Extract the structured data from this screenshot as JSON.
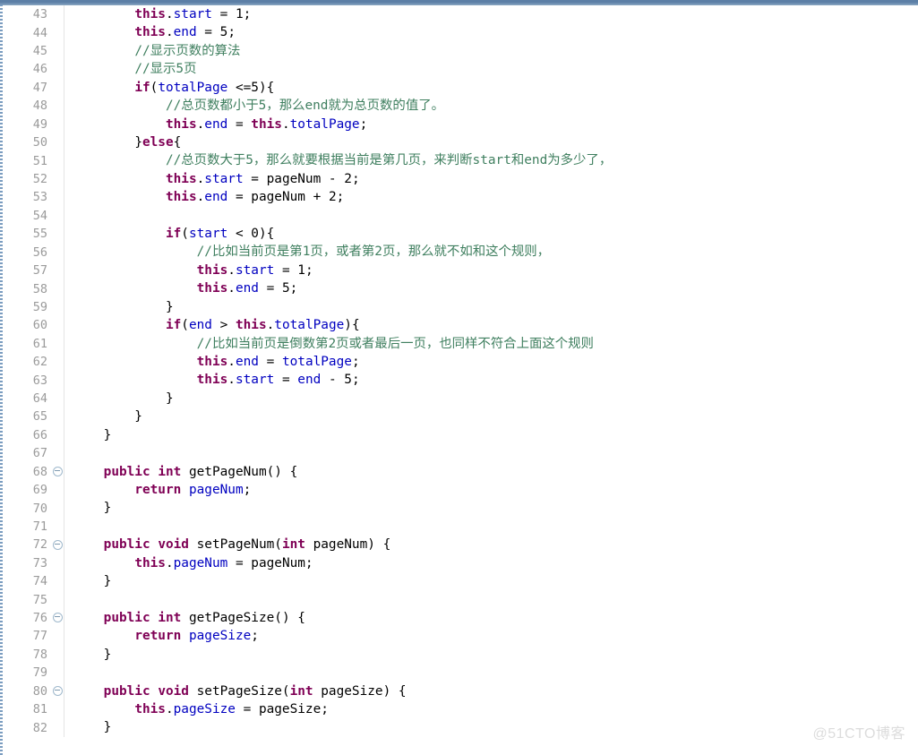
{
  "window": {
    "chrome_accent": "#5c7fa6",
    "background": "#ffffff"
  },
  "editor": {
    "language": "Java",
    "first_visible_line": 43,
    "last_visible_line": 82,
    "gutter_separator_color": "#e4e4e4",
    "line_number_color": "#9a9a9a",
    "fold_marker_icon": "collapse-circle-minus-icon",
    "theme": {
      "keyword": "#7f0055",
      "field": "#0000c0",
      "comment": "#3f7f5f",
      "text": "#000000"
    }
  },
  "watermark": {
    "text": "@51CTO博客",
    "color": "#dcdcdc"
  },
  "code_lines": [
    {
      "n": 43,
      "fold": false,
      "tokens": [
        {
          "t": "        ",
          "c": "plain"
        },
        {
          "t": "this",
          "c": "kw"
        },
        {
          "t": ".",
          "c": "punc"
        },
        {
          "t": "start",
          "c": "fld"
        },
        {
          "t": " = ",
          "c": "punc"
        },
        {
          "t": "1",
          "c": "num"
        },
        {
          "t": ";",
          "c": "punc"
        }
      ]
    },
    {
      "n": 44,
      "fold": false,
      "tokens": [
        {
          "t": "        ",
          "c": "plain"
        },
        {
          "t": "this",
          "c": "kw"
        },
        {
          "t": ".",
          "c": "punc"
        },
        {
          "t": "end",
          "c": "fld"
        },
        {
          "t": " = ",
          "c": "punc"
        },
        {
          "t": "5",
          "c": "num"
        },
        {
          "t": ";",
          "c": "punc"
        }
      ]
    },
    {
      "n": 45,
      "fold": false,
      "tokens": [
        {
          "t": "        ",
          "c": "plain"
        },
        {
          "t": "//显示页数的算法",
          "c": "cmt"
        }
      ]
    },
    {
      "n": 46,
      "fold": false,
      "tokens": [
        {
          "t": "        ",
          "c": "plain"
        },
        {
          "t": "//显示5页",
          "c": "cmt"
        }
      ]
    },
    {
      "n": 47,
      "fold": false,
      "tokens": [
        {
          "t": "        ",
          "c": "plain"
        },
        {
          "t": "if",
          "c": "kw"
        },
        {
          "t": "(",
          "c": "punc"
        },
        {
          "t": "totalPage",
          "c": "fld"
        },
        {
          "t": " <=5){",
          "c": "punc"
        }
      ]
    },
    {
      "n": 48,
      "fold": false,
      "tokens": [
        {
          "t": "            ",
          "c": "plain"
        },
        {
          "t": "//总页数都小于5，那么end就为总页数的值了。",
          "c": "cmt"
        }
      ]
    },
    {
      "n": 49,
      "fold": false,
      "tokens": [
        {
          "t": "            ",
          "c": "plain"
        },
        {
          "t": "this",
          "c": "kw"
        },
        {
          "t": ".",
          "c": "punc"
        },
        {
          "t": "end",
          "c": "fld"
        },
        {
          "t": " = ",
          "c": "punc"
        },
        {
          "t": "this",
          "c": "kw"
        },
        {
          "t": ".",
          "c": "punc"
        },
        {
          "t": "totalPage",
          "c": "fld"
        },
        {
          "t": ";",
          "c": "punc"
        }
      ]
    },
    {
      "n": 50,
      "fold": false,
      "tokens": [
        {
          "t": "        ",
          "c": "plain"
        },
        {
          "t": "}",
          "c": "punc"
        },
        {
          "t": "else",
          "c": "kw"
        },
        {
          "t": "{",
          "c": "punc"
        }
      ]
    },
    {
      "n": 51,
      "fold": false,
      "tokens": [
        {
          "t": "            ",
          "c": "plain"
        },
        {
          "t": "//总页数大于5，那么就要根据当前是第几页，来判断start和end为多少了，",
          "c": "cmt"
        }
      ]
    },
    {
      "n": 52,
      "fold": false,
      "tokens": [
        {
          "t": "            ",
          "c": "plain"
        },
        {
          "t": "this",
          "c": "kw"
        },
        {
          "t": ".",
          "c": "punc"
        },
        {
          "t": "start",
          "c": "fld"
        },
        {
          "t": " = pageNum - ",
          "c": "punc"
        },
        {
          "t": "2",
          "c": "num"
        },
        {
          "t": ";",
          "c": "punc"
        }
      ]
    },
    {
      "n": 53,
      "fold": false,
      "tokens": [
        {
          "t": "            ",
          "c": "plain"
        },
        {
          "t": "this",
          "c": "kw"
        },
        {
          "t": ".",
          "c": "punc"
        },
        {
          "t": "end",
          "c": "fld"
        },
        {
          "t": " = pageNum + ",
          "c": "punc"
        },
        {
          "t": "2",
          "c": "num"
        },
        {
          "t": ";",
          "c": "punc"
        }
      ]
    },
    {
      "n": 54,
      "fold": false,
      "tokens": [
        {
          "t": "",
          "c": "plain"
        }
      ]
    },
    {
      "n": 55,
      "fold": false,
      "tokens": [
        {
          "t": "            ",
          "c": "plain"
        },
        {
          "t": "if",
          "c": "kw"
        },
        {
          "t": "(",
          "c": "punc"
        },
        {
          "t": "start",
          "c": "fld"
        },
        {
          "t": " < ",
          "c": "punc"
        },
        {
          "t": "0",
          "c": "num"
        },
        {
          "t": "){",
          "c": "punc"
        }
      ]
    },
    {
      "n": 56,
      "fold": false,
      "tokens": [
        {
          "t": "                ",
          "c": "plain"
        },
        {
          "t": "//比如当前页是第1页，或者第2页，那么就不如和这个规则，",
          "c": "cmt"
        }
      ]
    },
    {
      "n": 57,
      "fold": false,
      "tokens": [
        {
          "t": "                ",
          "c": "plain"
        },
        {
          "t": "this",
          "c": "kw"
        },
        {
          "t": ".",
          "c": "punc"
        },
        {
          "t": "start",
          "c": "fld"
        },
        {
          "t": " = ",
          "c": "punc"
        },
        {
          "t": "1",
          "c": "num"
        },
        {
          "t": ";",
          "c": "punc"
        }
      ]
    },
    {
      "n": 58,
      "fold": false,
      "tokens": [
        {
          "t": "                ",
          "c": "plain"
        },
        {
          "t": "this",
          "c": "kw"
        },
        {
          "t": ".",
          "c": "punc"
        },
        {
          "t": "end",
          "c": "fld"
        },
        {
          "t": " = ",
          "c": "punc"
        },
        {
          "t": "5",
          "c": "num"
        },
        {
          "t": ";",
          "c": "punc"
        }
      ]
    },
    {
      "n": 59,
      "fold": false,
      "tokens": [
        {
          "t": "            }",
          "c": "punc"
        }
      ]
    },
    {
      "n": 60,
      "fold": false,
      "tokens": [
        {
          "t": "            ",
          "c": "plain"
        },
        {
          "t": "if",
          "c": "kw"
        },
        {
          "t": "(",
          "c": "punc"
        },
        {
          "t": "end",
          "c": "fld"
        },
        {
          "t": " > ",
          "c": "punc"
        },
        {
          "t": "this",
          "c": "kw"
        },
        {
          "t": ".",
          "c": "punc"
        },
        {
          "t": "totalPage",
          "c": "fld"
        },
        {
          "t": "){",
          "c": "punc"
        }
      ]
    },
    {
      "n": 61,
      "fold": false,
      "tokens": [
        {
          "t": "                ",
          "c": "plain"
        },
        {
          "t": "//比如当前页是倒数第2页或者最后一页，也同样不符合上面这个规则",
          "c": "cmt"
        }
      ]
    },
    {
      "n": 62,
      "fold": false,
      "tokens": [
        {
          "t": "                ",
          "c": "plain"
        },
        {
          "t": "this",
          "c": "kw"
        },
        {
          "t": ".",
          "c": "punc"
        },
        {
          "t": "end",
          "c": "fld"
        },
        {
          "t": " = ",
          "c": "punc"
        },
        {
          "t": "totalPage",
          "c": "fld"
        },
        {
          "t": ";",
          "c": "punc"
        }
      ]
    },
    {
      "n": 63,
      "fold": false,
      "tokens": [
        {
          "t": "                ",
          "c": "plain"
        },
        {
          "t": "this",
          "c": "kw"
        },
        {
          "t": ".",
          "c": "punc"
        },
        {
          "t": "start",
          "c": "fld"
        },
        {
          "t": " = ",
          "c": "punc"
        },
        {
          "t": "end",
          "c": "fld"
        },
        {
          "t": " - ",
          "c": "punc"
        },
        {
          "t": "5",
          "c": "num"
        },
        {
          "t": ";",
          "c": "punc"
        }
      ]
    },
    {
      "n": 64,
      "fold": false,
      "tokens": [
        {
          "t": "            }",
          "c": "punc"
        }
      ]
    },
    {
      "n": 65,
      "fold": false,
      "tokens": [
        {
          "t": "        }",
          "c": "punc"
        }
      ]
    },
    {
      "n": 66,
      "fold": false,
      "tokens": [
        {
          "t": "    }",
          "c": "punc"
        }
      ]
    },
    {
      "n": 67,
      "fold": false,
      "tokens": [
        {
          "t": "",
          "c": "plain"
        }
      ]
    },
    {
      "n": 68,
      "fold": true,
      "tokens": [
        {
          "t": "    ",
          "c": "plain"
        },
        {
          "t": "public",
          "c": "kw"
        },
        {
          "t": " ",
          "c": "punc"
        },
        {
          "t": "int",
          "c": "kw"
        },
        {
          "t": " getPageNum() {",
          "c": "punc"
        }
      ]
    },
    {
      "n": 69,
      "fold": false,
      "tokens": [
        {
          "t": "        ",
          "c": "plain"
        },
        {
          "t": "return",
          "c": "kw"
        },
        {
          "t": " ",
          "c": "punc"
        },
        {
          "t": "pageNum",
          "c": "fld"
        },
        {
          "t": ";",
          "c": "punc"
        }
      ]
    },
    {
      "n": 70,
      "fold": false,
      "tokens": [
        {
          "t": "    }",
          "c": "punc"
        }
      ]
    },
    {
      "n": 71,
      "fold": false,
      "tokens": [
        {
          "t": "",
          "c": "plain"
        }
      ]
    },
    {
      "n": 72,
      "fold": true,
      "tokens": [
        {
          "t": "    ",
          "c": "plain"
        },
        {
          "t": "public",
          "c": "kw"
        },
        {
          "t": " ",
          "c": "punc"
        },
        {
          "t": "void",
          "c": "kw"
        },
        {
          "t": " setPageNum(",
          "c": "punc"
        },
        {
          "t": "int",
          "c": "kw"
        },
        {
          "t": " pageNum) {",
          "c": "punc"
        }
      ]
    },
    {
      "n": 73,
      "fold": false,
      "tokens": [
        {
          "t": "        ",
          "c": "plain"
        },
        {
          "t": "this",
          "c": "kw"
        },
        {
          "t": ".",
          "c": "punc"
        },
        {
          "t": "pageNum",
          "c": "fld"
        },
        {
          "t": " = pageNum;",
          "c": "punc"
        }
      ]
    },
    {
      "n": 74,
      "fold": false,
      "tokens": [
        {
          "t": "    }",
          "c": "punc"
        }
      ]
    },
    {
      "n": 75,
      "fold": false,
      "tokens": [
        {
          "t": "",
          "c": "plain"
        }
      ]
    },
    {
      "n": 76,
      "fold": true,
      "tokens": [
        {
          "t": "    ",
          "c": "plain"
        },
        {
          "t": "public",
          "c": "kw"
        },
        {
          "t": " ",
          "c": "punc"
        },
        {
          "t": "int",
          "c": "kw"
        },
        {
          "t": " getPageSize() {",
          "c": "punc"
        }
      ]
    },
    {
      "n": 77,
      "fold": false,
      "tokens": [
        {
          "t": "        ",
          "c": "plain"
        },
        {
          "t": "return",
          "c": "kw"
        },
        {
          "t": " ",
          "c": "punc"
        },
        {
          "t": "pageSize",
          "c": "fld"
        },
        {
          "t": ";",
          "c": "punc"
        }
      ]
    },
    {
      "n": 78,
      "fold": false,
      "tokens": [
        {
          "t": "    }",
          "c": "punc"
        }
      ]
    },
    {
      "n": 79,
      "fold": false,
      "tokens": [
        {
          "t": "",
          "c": "plain"
        }
      ]
    },
    {
      "n": 80,
      "fold": true,
      "tokens": [
        {
          "t": "    ",
          "c": "plain"
        },
        {
          "t": "public",
          "c": "kw"
        },
        {
          "t": " ",
          "c": "punc"
        },
        {
          "t": "void",
          "c": "kw"
        },
        {
          "t": " setPageSize(",
          "c": "punc"
        },
        {
          "t": "int",
          "c": "kw"
        },
        {
          "t": " pageSize) {",
          "c": "punc"
        }
      ]
    },
    {
      "n": 81,
      "fold": false,
      "tokens": [
        {
          "t": "        ",
          "c": "plain"
        },
        {
          "t": "this",
          "c": "kw"
        },
        {
          "t": ".",
          "c": "punc"
        },
        {
          "t": "pageSize",
          "c": "fld"
        },
        {
          "t": " = pageSize;",
          "c": "punc"
        }
      ]
    },
    {
      "n": 82,
      "fold": false,
      "tokens": [
        {
          "t": "    }",
          "c": "punc"
        }
      ]
    }
  ]
}
